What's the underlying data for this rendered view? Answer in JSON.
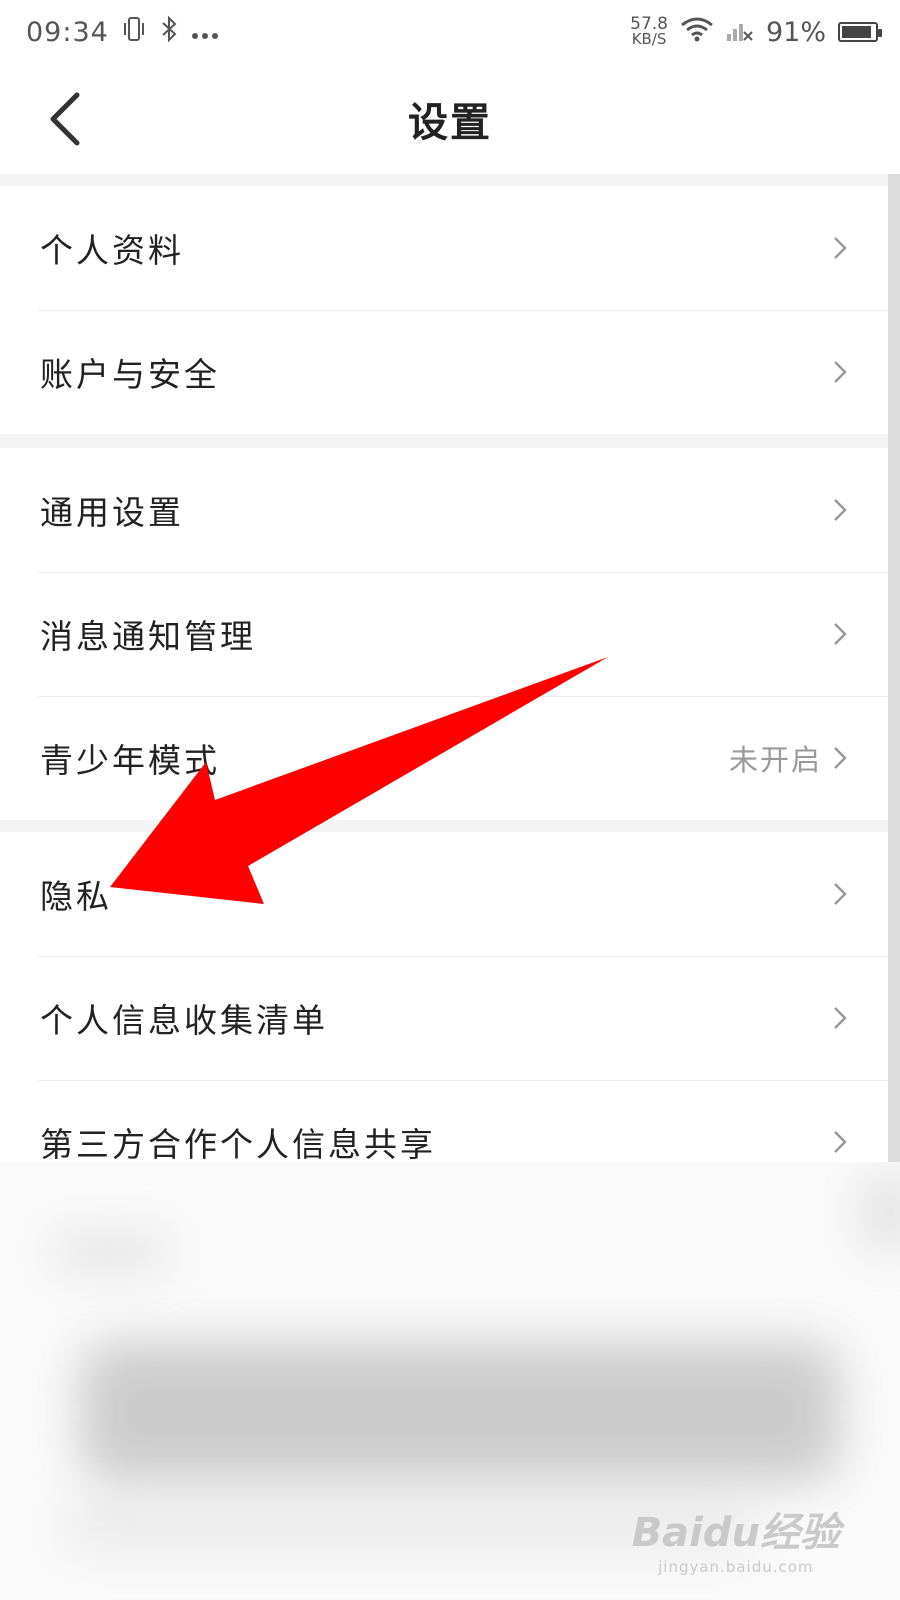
{
  "status_bar": {
    "time": "09:34",
    "net_speed_value": "57.8",
    "net_speed_unit": "KB/S",
    "battery_text": "91%",
    "battery_level": 0.91
  },
  "header": {
    "title": "设置"
  },
  "groups": [
    {
      "items": [
        {
          "label": "个人资料"
        },
        {
          "label": "账户与安全"
        }
      ]
    },
    {
      "items": [
        {
          "label": "通用设置"
        },
        {
          "label": "消息通知管理"
        },
        {
          "label": "青少年模式",
          "value": "未开启"
        }
      ]
    },
    {
      "items": [
        {
          "label": "隐私"
        },
        {
          "label": "个人信息收集清单"
        },
        {
          "label": "第三方合作个人信息共享"
        }
      ]
    }
  ],
  "annotation": {
    "arrow_color": "#ff0000"
  },
  "watermark": {
    "brand": "Baidu经验",
    "url": "jingyan.baidu.com"
  }
}
